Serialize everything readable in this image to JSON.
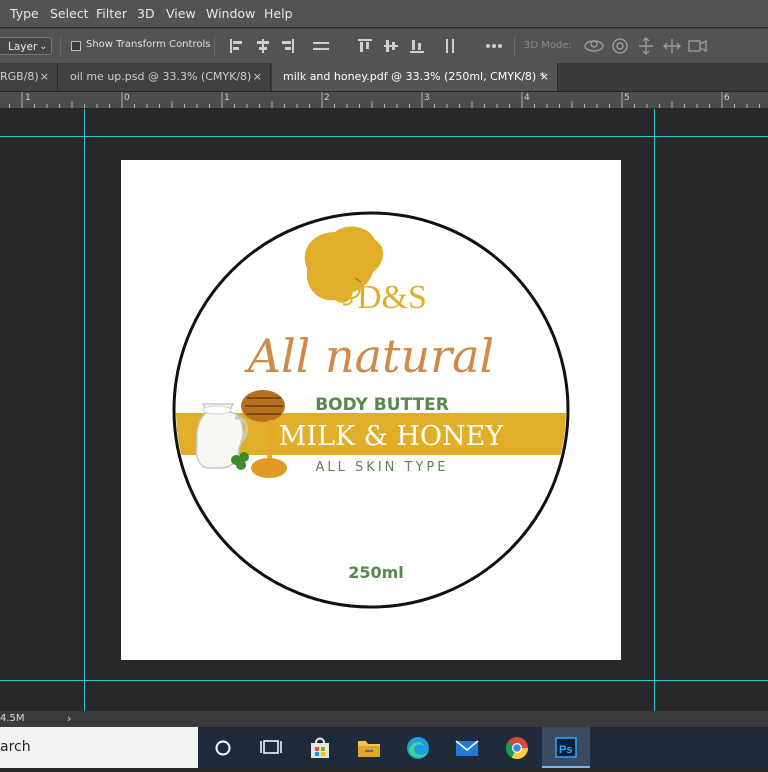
{
  "menu": {
    "items": [
      "Type",
      "Select",
      "Filter",
      "3D",
      "View",
      "Window",
      "Help"
    ]
  },
  "options": {
    "layer_select": "Layer",
    "show_transform_label": "Show Transform Controls",
    "mode_label": "3D Mode:"
  },
  "tabs": [
    {
      "label": "RGB/8)",
      "close": "×"
    },
    {
      "label": "oil me up.psd @ 33.3% (CMYK/8)",
      "close": "×"
    },
    {
      "label": "milk and honey.pdf @ 33.3% (250ml, CMYK/8) *",
      "close": "×"
    }
  ],
  "ruler": {
    "ticks": [
      "1",
      "0",
      "1",
      "2",
      "3",
      "4",
      "5",
      "6"
    ]
  },
  "label": {
    "brand": "D&S",
    "script_text": "All natural",
    "subtitle": "BODY BUTTER",
    "banner": "MILK & HONEY",
    "skin_type": "ALL SKIN TYPE",
    "volume": "250ml"
  },
  "colors": {
    "gold": "#e1ae2a",
    "script": "#cf8a4a",
    "green": "#57894a",
    "guide": "#31c8d8"
  },
  "status": {
    "doc_size": "4.5M",
    "arrow": "›"
  },
  "taskbar": {
    "search_text": "arch"
  }
}
